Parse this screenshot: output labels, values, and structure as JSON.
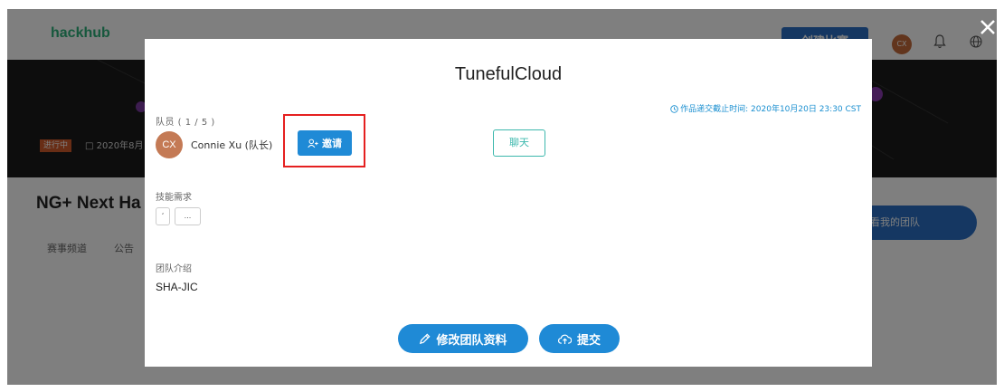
{
  "background": {
    "logo": "hackhub",
    "create_button": "创建比赛",
    "user_initials": "CX",
    "status_tag": "进行中",
    "date_text": "□ 2020年8月",
    "event_title": "NG+ Next Ha",
    "tabs": [
      "赛事频道",
      "公告"
    ],
    "view_team_button": "看我的团队"
  },
  "modal": {
    "title": "TunefulCloud",
    "deadline": "作品递交截止时间: 2020年10月20日 23:30 CST",
    "members_label": "队员 ( 1 / 5 )",
    "member": {
      "initials": "CX",
      "name": "Connie Xu (队长)"
    },
    "invite_button": "邀请",
    "chat_button": "聊天",
    "skills_label": "技能需求",
    "skills": [
      "‘",
      "..."
    ],
    "intro_label": "团队介绍",
    "intro_text": "SHA-JIC",
    "edit_button": "修改团队资料",
    "submit_button": "提交"
  },
  "colors": {
    "accent": "#1f8ad6",
    "chat": "#3cb8ad",
    "highlight": "#e52020",
    "avatar": "#c47a55"
  }
}
